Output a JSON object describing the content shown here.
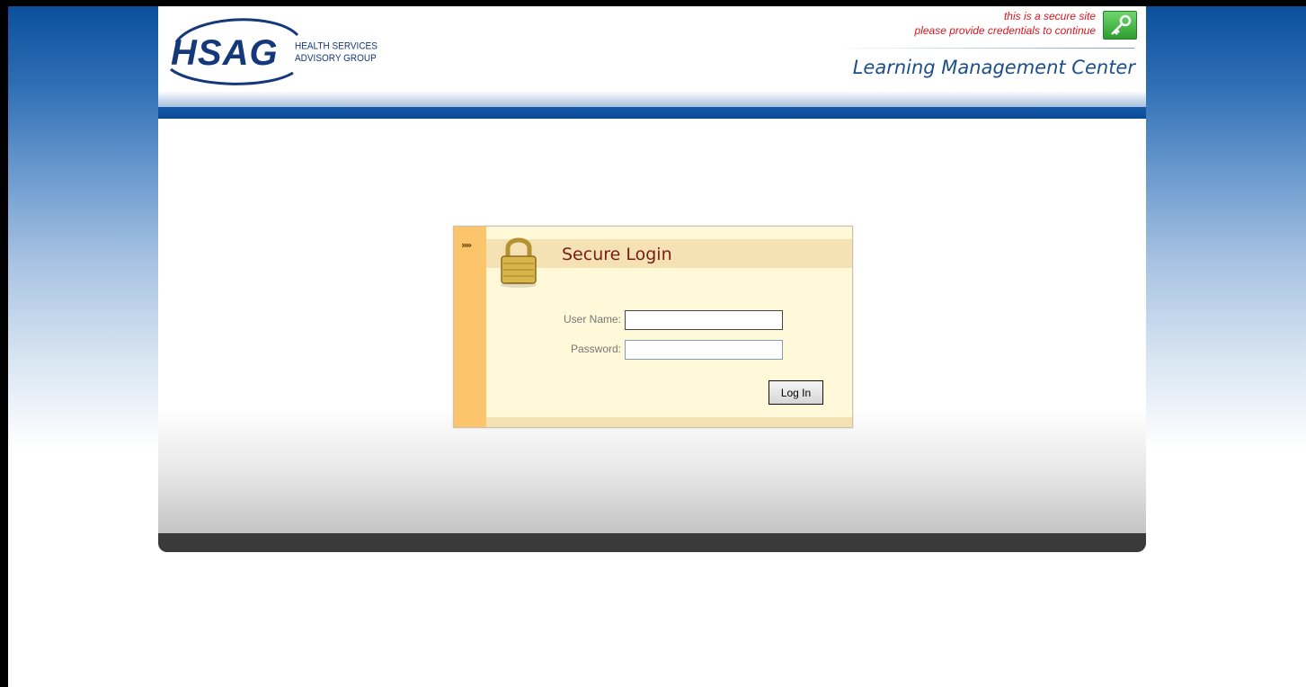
{
  "brand": {
    "logo_text": "HSAG",
    "logo_sub_line1": "HEALTH SERVICES",
    "logo_sub_line2": "ADVISORY GROUP",
    "color_navy": "#14387a"
  },
  "header": {
    "secure_line1": "this is a secure site",
    "secure_line2": "please provide credentials to continue",
    "secure_icon": "key-icon",
    "app_title": "Learning Management Center"
  },
  "login": {
    "chevrons": "»»",
    "lock_icon": "padlock-icon",
    "title": "Secure Login",
    "username_label": "User Name:",
    "username_value": "",
    "password_label": "Password:",
    "password_value": "",
    "submit_label": "Log In",
    "color_accent": "#fcc46b",
    "color_title": "#7a1b1b"
  }
}
